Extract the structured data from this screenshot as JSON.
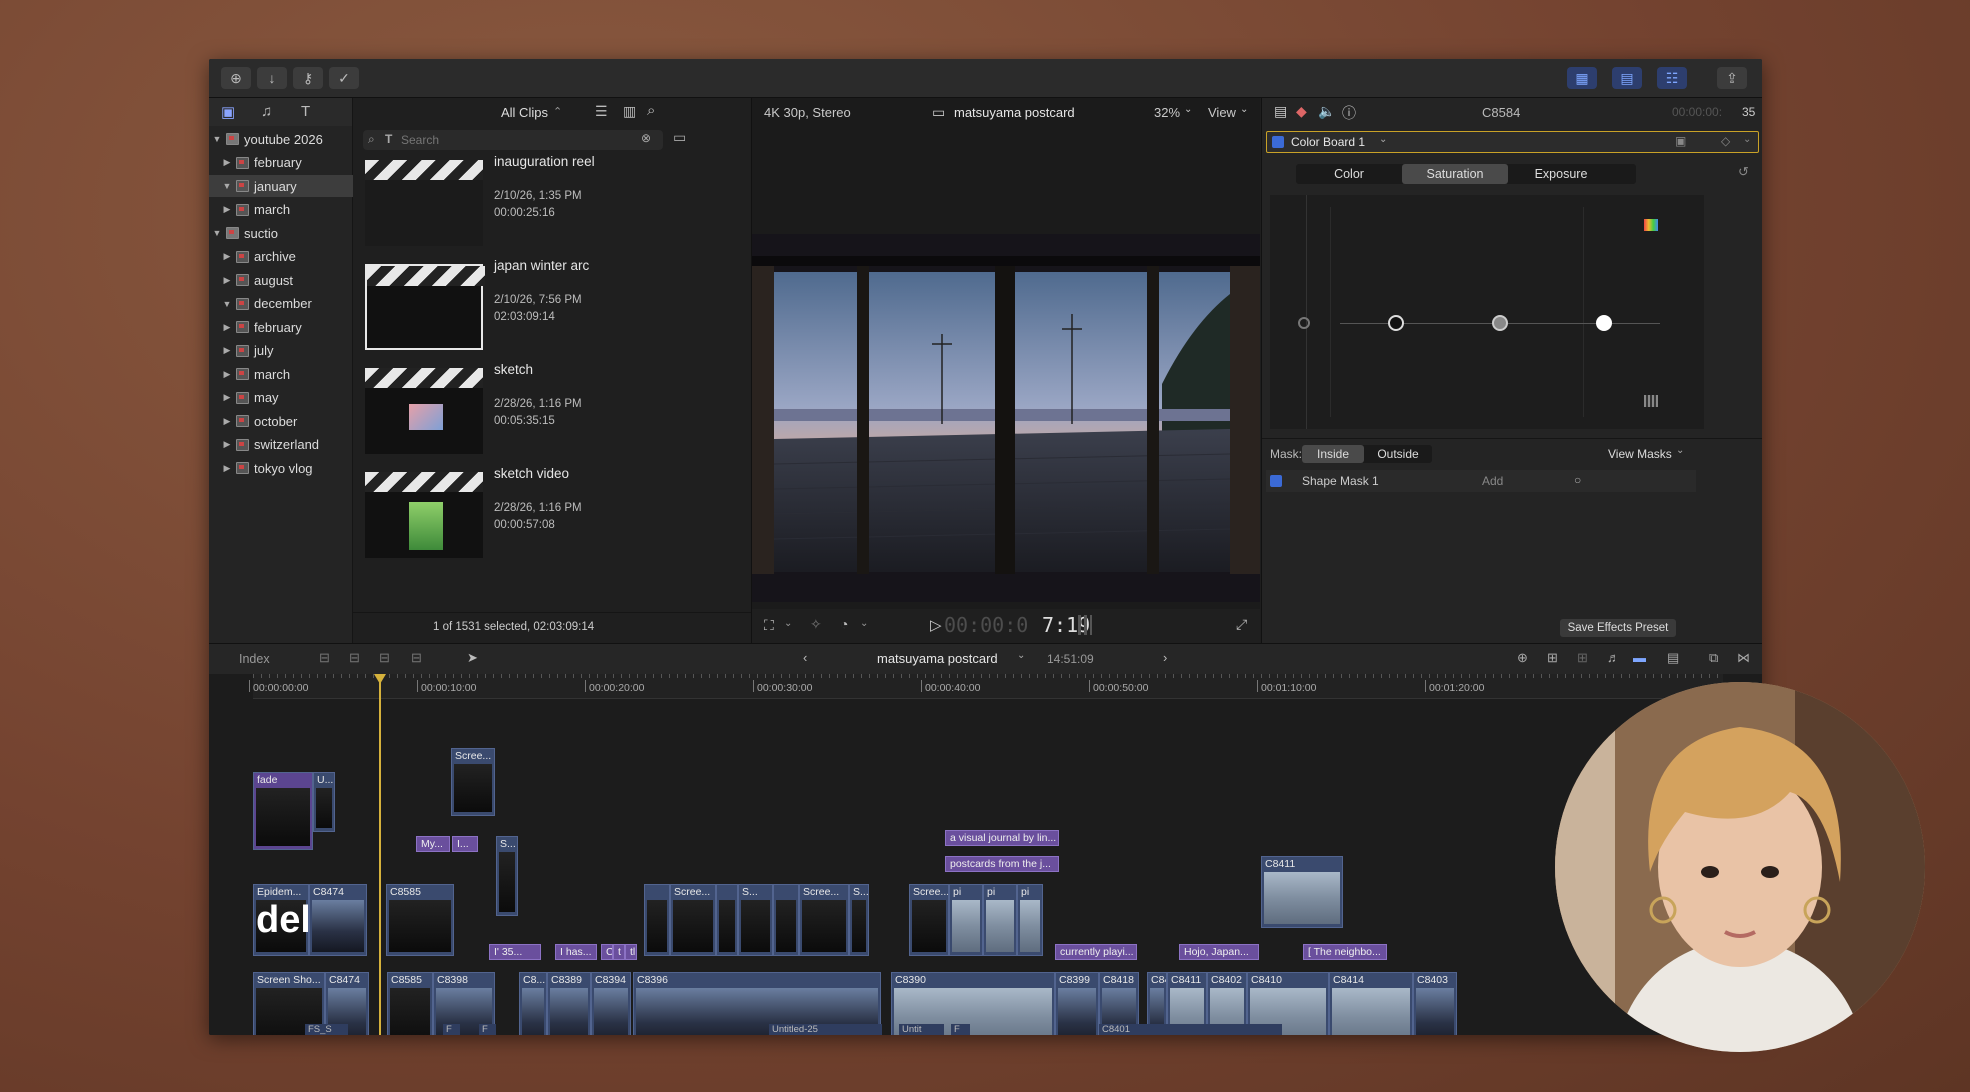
{
  "toolbar": {
    "left_icons": [
      "import-icon",
      "download-icon",
      "key-icon",
      "check-circle-icon"
    ],
    "right_icons": [
      "browser-layout-icon",
      "timeline-layout-icon",
      "inspector-layout-icon",
      "share-icon"
    ]
  },
  "libraries": {
    "items": [
      {
        "label": "youtube 2026",
        "level": 0,
        "open": true
      },
      {
        "label": "february",
        "level": 1,
        "open": false
      },
      {
        "label": "january",
        "level": 1,
        "open": true,
        "selected": true
      },
      {
        "label": "march",
        "level": 1,
        "open": false
      },
      {
        "label": "suctio",
        "level": 0,
        "open": true
      },
      {
        "label": "archive",
        "level": 1,
        "open": false
      },
      {
        "label": "august",
        "level": 1,
        "open": false
      },
      {
        "label": "december",
        "level": 1,
        "open": true
      },
      {
        "label": "february",
        "level": 1,
        "open": false
      },
      {
        "label": "july",
        "level": 1,
        "open": false
      },
      {
        "label": "march",
        "level": 1,
        "open": false
      },
      {
        "label": "may",
        "level": 1,
        "open": false
      },
      {
        "label": "october",
        "level": 1,
        "open": false
      },
      {
        "label": "switzerland",
        "level": 1,
        "open": false
      },
      {
        "label": "tokyo vlog",
        "level": 1,
        "open": false
      }
    ]
  },
  "browser": {
    "filter_label": "All Clips",
    "search_placeholder": "Search",
    "clips": [
      {
        "title": "inauguration reel",
        "date": "2/10/26, 1:35 PM",
        "duration": "00:00:25:16"
      },
      {
        "title": "japan winter arc",
        "date": "2/10/26, 7:56 PM",
        "duration": "02:03:09:14"
      },
      {
        "title": "sketch",
        "date": "2/28/26, 1:16 PM",
        "duration": "00:05:35:15"
      },
      {
        "title": "sketch video",
        "date": "2/28/26, 1:16 PM",
        "duration": "00:00:57:08"
      }
    ],
    "status": "1 of 1531 selected, 02:03:09:14"
  },
  "viewer": {
    "format": "4K 30p, Stereo",
    "project": "matsuyama postcard",
    "zoom": "32%",
    "view_label": "View",
    "timecode_dim": "00:00:0",
    "timecode_bright": "7:19"
  },
  "inspector": {
    "clip_name": "C8584",
    "timecode_dim": "00:00:00:",
    "timecode_bright": "35",
    "effect_label": "Color Board 1",
    "tabs": [
      "Color",
      "Saturation",
      "Exposure"
    ],
    "active_tab": "Saturation",
    "mask_label": "Mask:",
    "mask_inside": "Inside",
    "mask_outside": "Outside",
    "view_masks": "View Masks",
    "shape_mask": "Shape Mask 1",
    "add_label": "Add",
    "save_preset": "Save Effects Preset",
    "saturation_points": {
      "master": 0.0,
      "shadows": 0.17,
      "midtones": 0.5,
      "highlights": 0.83
    }
  },
  "timeline": {
    "index_label": "Index",
    "project": "matsuyama postcard",
    "duration": "14:51:09",
    "ruler": [
      "00:00:00:00",
      "00:00:10:00",
      "00:00:20:00",
      "00:00:30:00",
      "00:00:40:00",
      "00:00:50:00",
      "00:01:10:00",
      "00:01:20:00"
    ],
    "titles": [
      "fade",
      "U...",
      "My...",
      "I...",
      "S...",
      "I' 35...",
      "I has...",
      "C",
      "t",
      "tl",
      "a visual journal by lin...",
      "postcards from the j...",
      "currently playi...",
      "Hojo, Japan...",
      "[ The neighbo..."
    ],
    "upper_clips": [
      "Scree...",
      "Epidem...",
      "C8474",
      "C8585",
      "Scree...",
      "S...",
      "Scree...",
      "S...",
      "Scree...",
      "pi",
      "pi",
      "pi",
      "C8411"
    ],
    "upper_text": "del",
    "main_clips": [
      "Screen Sho...",
      "C8474",
      "C8585",
      "C8398",
      "C8...",
      "C8389",
      "C8394",
      "C8396",
      "C8390",
      "C8399",
      "C8418",
      "C84...",
      "C8411",
      "C8402",
      "C8410",
      "C8414",
      "C8403"
    ],
    "bottom_labels": [
      "FS_S",
      "F",
      "F",
      "Untitled-25",
      "Untit",
      "F",
      "C8401"
    ]
  }
}
